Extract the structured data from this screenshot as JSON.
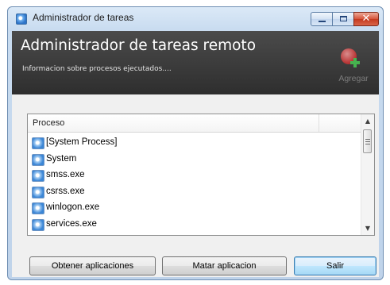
{
  "window": {
    "title": "Administrador de tareas",
    "controls": {
      "minimize": "minimize",
      "maximize": "maximize",
      "close": "✕"
    }
  },
  "header": {
    "title": "Administrador de tareas remoto",
    "subtitle": "Informacion sobre procesos ejecutados....",
    "add_label": "Agregar"
  },
  "list": {
    "column_header": "Proceso",
    "items": [
      "[System Process]",
      "System",
      "smss.exe",
      "csrss.exe",
      "winlogon.exe",
      "services.exe"
    ]
  },
  "buttons": {
    "obtener": "Obtener aplicaciones",
    "matar": "Matar aplicacion",
    "salir": "Salir"
  },
  "colors": {
    "header_background": "#3a3a3a",
    "close_button": "#c9452a",
    "default_button_accent": "#3c7fb1"
  }
}
